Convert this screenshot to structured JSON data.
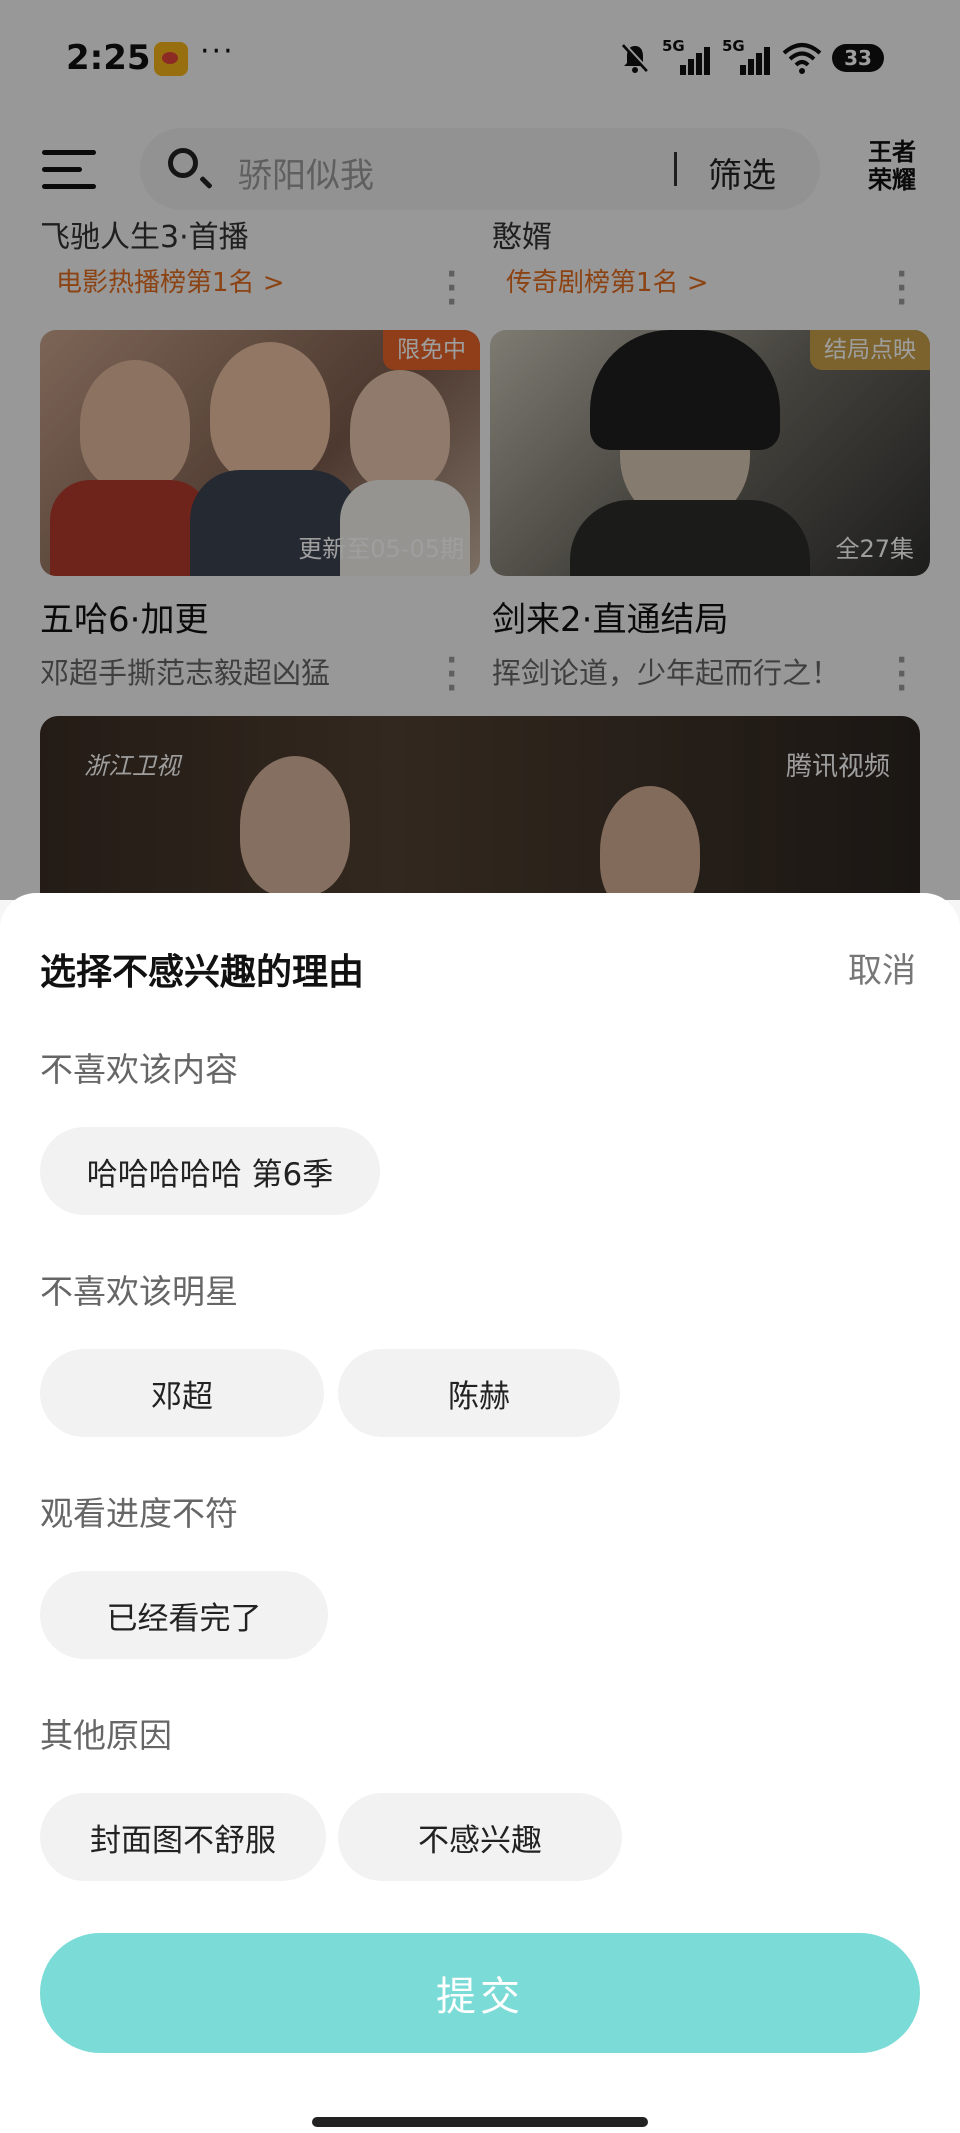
{
  "status_bar": {
    "time": "2:25",
    "app_icon": "weibo-icon",
    "more": "···",
    "network_1": "5G",
    "network_2": "5G",
    "battery": "33"
  },
  "header": {
    "menu_icon": "menu-icon",
    "search_placeholder": "骄阳似我",
    "filter_label": "筛选",
    "game_logo": "王者荣耀"
  },
  "feed": {
    "top_cards": [
      {
        "title": "飞驰人生3·首播",
        "rank": "电影热播榜第1名 >"
      },
      {
        "title": "憨婿",
        "rank": "传奇剧榜第1名 >"
      }
    ],
    "cards": [
      {
        "badge": "限免中",
        "thumb_info": "更新至05-05期",
        "title": "五哈6·加更",
        "subtitle": "邓超手撕范志毅超凶猛",
        "badge_color": "#e8632a"
      },
      {
        "badge": "结局点映",
        "thumb_info": "全27集",
        "title": "剑来2·直通结局",
        "subtitle": "挥剑论道，少年起而行之！",
        "badge_color": "#c9a04a"
      }
    ],
    "banner": {
      "channel_logo": "浙江卫视",
      "platform_logo": "腾讯视频"
    }
  },
  "sheet": {
    "title": "选择不感兴趣的理由",
    "cancel": "取消",
    "sections": [
      {
        "label": "不喜欢该内容",
        "options": [
          "哈哈哈哈哈 第6季"
        ]
      },
      {
        "label": "不喜欢该明星",
        "options": [
          "邓超",
          "陈赫"
        ]
      },
      {
        "label": "观看进度不符",
        "options": [
          "已经看完了"
        ]
      },
      {
        "label": "其他原因",
        "options": [
          "封面图不舒服",
          "不感兴趣"
        ]
      }
    ],
    "submit": "提交",
    "submit_color": "#7bdbd6"
  }
}
